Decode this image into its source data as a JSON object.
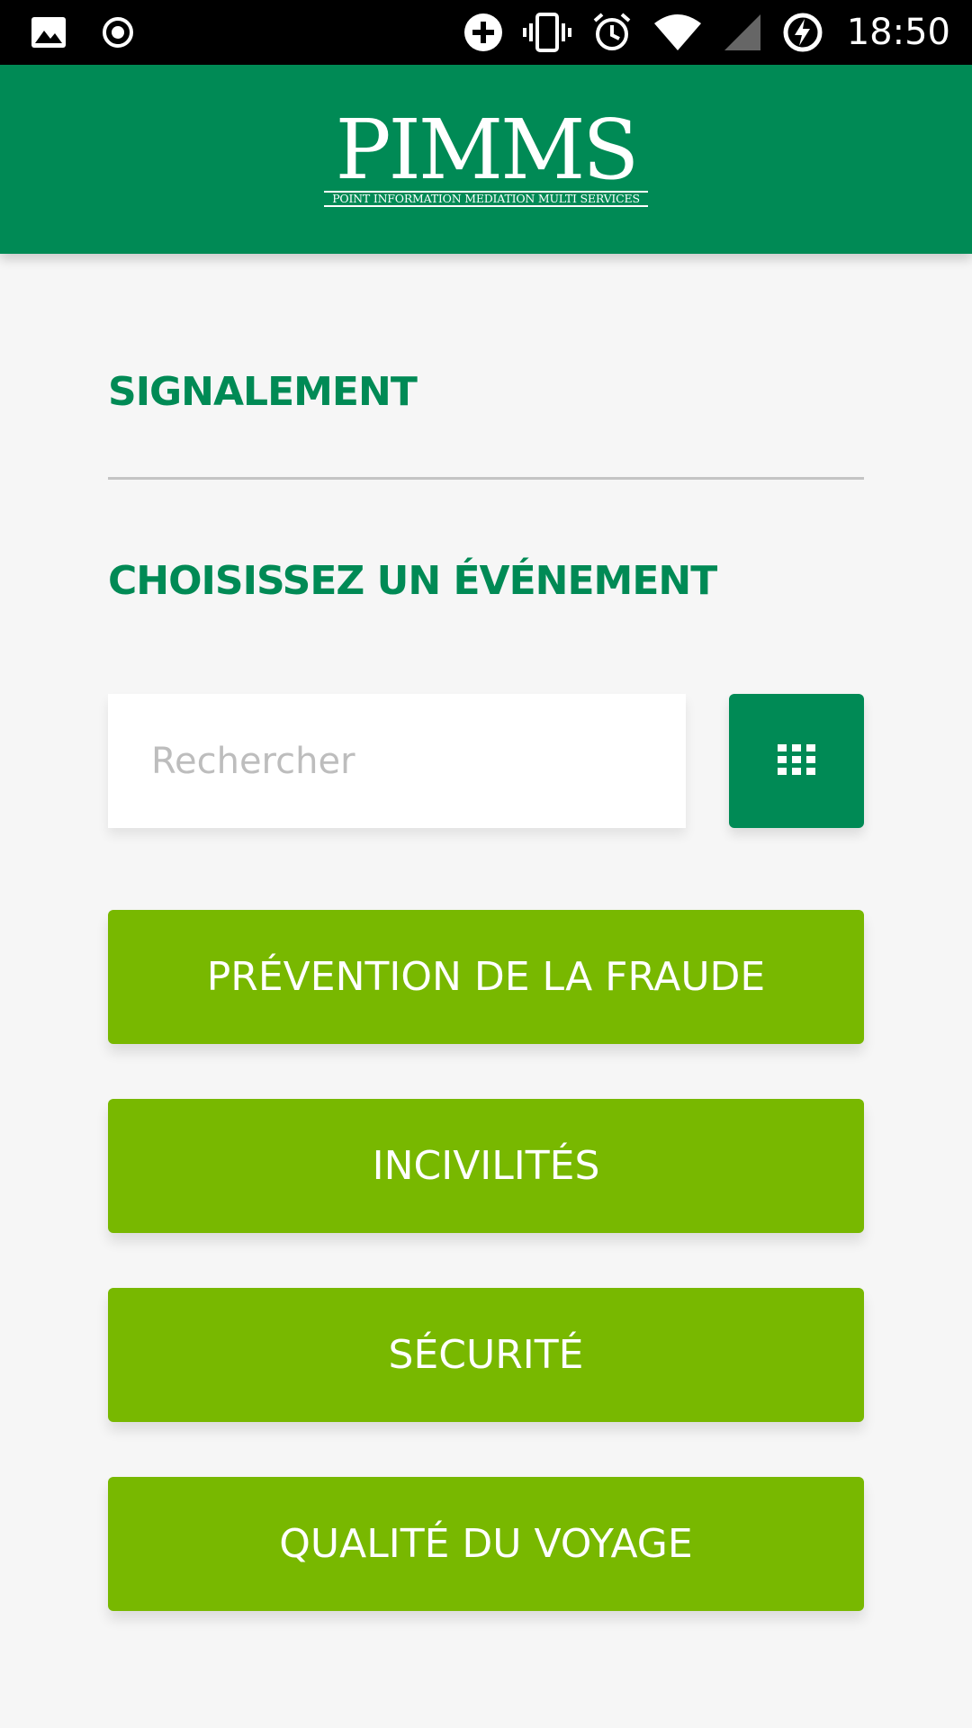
{
  "status_bar": {
    "time": "18:50",
    "icons": [
      "gallery-icon",
      "record-icon",
      "add-circle-icon",
      "vibrate-icon",
      "alarm-icon",
      "wifi-icon",
      "cell-signal-icon",
      "battery-charging-icon"
    ]
  },
  "header": {
    "logo_word": "PIMMS",
    "logo_tagline": "POINT INFORMATION MEDIATION MULTI SERVICES",
    "background_color": "#008a55"
  },
  "main": {
    "section_title": "SIGNALEMENT",
    "subtitle": "CHOISISSEZ UN ÉVÉNEMENT",
    "search": {
      "placeholder": "Rechercher",
      "value": ""
    },
    "grid_button_icon": "grid-icon",
    "events": [
      {
        "label": "PRÉVENTION DE LA FRAUDE"
      },
      {
        "label": "INCIVILITÉS"
      },
      {
        "label": "SÉCURITÉ"
      },
      {
        "label": "QUALITÉ DU VOYAGE"
      }
    ]
  },
  "colors": {
    "accent_green": "#008a55",
    "event_button_green": "#78b800",
    "background": "#f6f6f6"
  }
}
